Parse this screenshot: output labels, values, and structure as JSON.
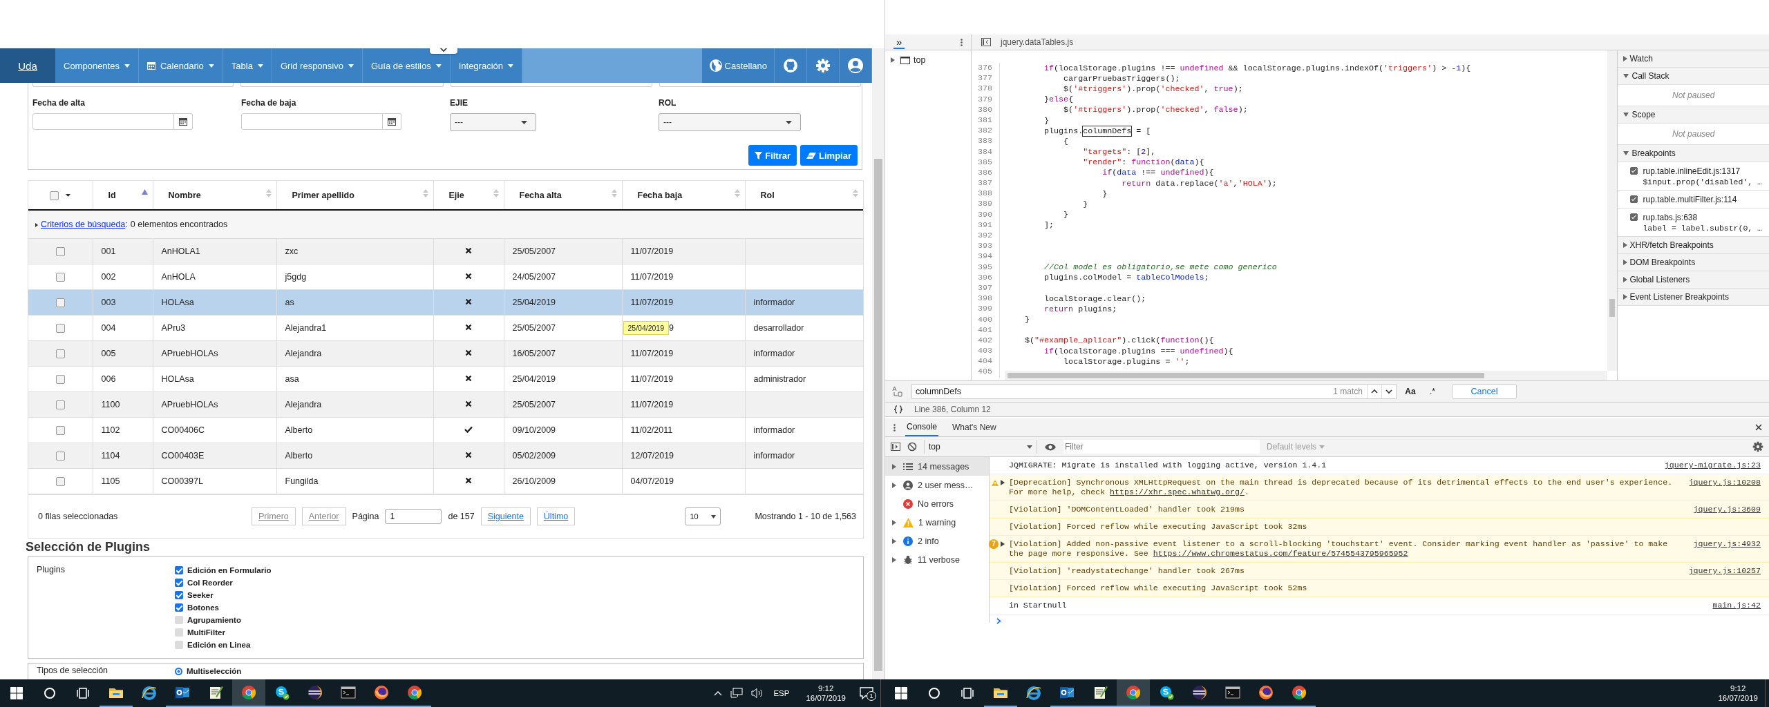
{
  "page": {
    "navbar": {
      "brand": "Uda",
      "menus": [
        {
          "label": "Componentes",
          "kind": "plain"
        },
        {
          "label": "Calendario",
          "kind": "calendar"
        },
        {
          "label": "Tabla",
          "kind": "plain"
        },
        {
          "label": "Grid responsivo",
          "kind": "plain"
        },
        {
          "label": "Guía de estilos",
          "kind": "plain"
        },
        {
          "label": "Integración",
          "kind": "plain"
        }
      ],
      "language": "Castellano"
    },
    "filters": [
      {
        "label": "Fecha de alta",
        "kind": "date"
      },
      {
        "label": "Fecha de baja",
        "kind": "date"
      },
      {
        "label": "EJIE",
        "kind": "select",
        "value": "---"
      },
      {
        "label": "ROL",
        "kind": "select",
        "value": "---"
      }
    ],
    "filter_buttons": [
      {
        "label": "Filtrar",
        "kind": "filter"
      },
      {
        "label": "Limpiar",
        "kind": "clear"
      }
    ],
    "table": {
      "select_all": {
        "checked": false
      },
      "columns": [
        {
          "label": "Id",
          "sorted": true
        },
        {
          "label": "Nombre",
          "sorted": false
        },
        {
          "label": "Primer apellido",
          "sorted": false
        },
        {
          "label": "Ejie",
          "sorted": false
        },
        {
          "label": "Fecha alta",
          "sorted": false
        },
        {
          "label": "Fecha baja",
          "sorted": false
        },
        {
          "label": "Rol",
          "sorted": false
        }
      ],
      "criteria": {
        "link": "Criterios de búsqueda",
        "separator": ":",
        "text": "0 elementos encontrados"
      },
      "rows": [
        {
          "checked": false,
          "selected": false,
          "id": "001",
          "nombre": "AnHOLA1",
          "apellido": "zxc",
          "ejie": false,
          "fecha_alta": "25/05/2007",
          "fecha_baja": "11/07/2019"
        },
        {
          "checked": false,
          "selected": false,
          "id": "002",
          "nombre": "AnHOLA",
          "apellido": "j5gdg",
          "ejie": false,
          "fecha_alta": "24/05/2007",
          "fecha_baja": "11/07/2019"
        },
        {
          "checked": false,
          "selected": true,
          "id": "003",
          "nombre": "HOLAsa",
          "apellido": "as",
          "ejie": false,
          "fecha_alta": "25/04/2019",
          "fecha_baja": "11/07/2019",
          "rol": "informador"
        },
        {
          "checked": false,
          "selected": false,
          "id": "004",
          "nombre": "APru3",
          "apellido": "Alejandra1",
          "ejie": false,
          "fecha_alta": "25/05/2007",
          "tooltip": "25/04/2019",
          "fecha_baja": "9",
          "rol": "desarrollador"
        },
        {
          "checked": false,
          "selected": false,
          "id": "005",
          "nombre": "APruebHOLAs",
          "apellido": "Alejandra",
          "ejie": false,
          "fecha_alta": "16/05/2007",
          "fecha_baja": "11/07/2019",
          "rol": "informador"
        },
        {
          "checked": false,
          "selected": false,
          "id": "006",
          "nombre": "HOLAsa",
          "apellido": "asa",
          "ejie": false,
          "fecha_alta": "25/04/2019",
          "fecha_baja": "11/07/2019",
          "rol": "administrador"
        },
        {
          "checked": false,
          "selected": false,
          "id": "1100",
          "nombre": "APruebHOLAs",
          "apellido": "Alejandra",
          "ejie": false,
          "fecha_alta": "25/05/2007",
          "fecha_baja": "11/07/2019"
        },
        {
          "checked": false,
          "selected": false,
          "id": "1102",
          "nombre": "CO00406C",
          "apellido": "Alberto",
          "ejie": true,
          "fecha_alta": "09/10/2009",
          "fecha_baja": "11/02/2011",
          "rol": "informador"
        },
        {
          "checked": false,
          "selected": false,
          "id": "1104",
          "nombre": "CO00403E",
          "apellido": "Alberto",
          "ejie": false,
          "fecha_alta": "05/02/2009",
          "fecha_baja": "12/07/2019",
          "rol": "informador"
        },
        {
          "checked": false,
          "selected": false,
          "id": "1105",
          "nombre": "CO00397L",
          "apellido": "Fungilda",
          "ejie": false,
          "fecha_alta": "26/10/2009",
          "fecha_baja": "04/07/2019"
        }
      ],
      "footer": {
        "selected_text": "0 filas seleccionadas",
        "pager": [
          {
            "label": "Primero",
            "disabled": true
          },
          {
            "label": "Anterior",
            "disabled": true
          }
        ],
        "page_label": "Página",
        "page_value": "1",
        "page_total": "de 157",
        "pager_next": [
          {
            "label": "Siguiente",
            "disabled": false
          },
          {
            "label": "Último",
            "disabled": false
          }
        ],
        "page_size": "10",
        "summary": "Mostrando 1 - 10 de 1,563"
      }
    },
    "plugins_heading": "Selección de Plugins",
    "plugins": {
      "label": "Plugins",
      "options": [
        {
          "label": "Edición en Formulario",
          "checked": true
        },
        {
          "label": "Col Reorder",
          "checked": true
        },
        {
          "label": "Seeker",
          "checked": true
        },
        {
          "label": "Botones",
          "checked": true
        },
        {
          "label": "Agrupamiento",
          "checked": false
        },
        {
          "label": "MultiFilter",
          "checked": false
        },
        {
          "label": "Edición en Linea",
          "checked": false
        }
      ]
    },
    "selection_types": {
      "label": "Tipos de selección",
      "options": [
        {
          "label": "Multiselección",
          "selected": true
        }
      ]
    }
  },
  "devtools": {
    "file_tab": "jquery.dataTables.js",
    "navigator": {
      "more": "»",
      "items": [
        {
          "label": "top"
        }
      ]
    },
    "code": {
      "lines": [
        {
          "n": "376",
          "tokens": [
            {
              "t": "        if",
              "kind": "kw"
            },
            {
              "t": "(localStorage.plugins !== ",
              "kind": "p"
            },
            {
              "t": "undefined",
              "kind": "kw"
            },
            {
              "t": " && localStorage.plugins.indexOf(",
              "kind": "p"
            },
            {
              "t": "'triggers'",
              "kind": "str"
            },
            {
              "t": ") > ",
              "kind": "p"
            },
            {
              "t": "-1",
              "kind": "num"
            },
            {
              "t": "){",
              "kind": "p"
            }
          ]
        },
        {
          "n": "377",
          "tokens": [
            {
              "t": "            cargarPruebasTriggers();",
              "kind": "p"
            }
          ]
        },
        {
          "n": "378",
          "tokens": [
            {
              "t": "            $(",
              "kind": "p"
            },
            {
              "t": "'#triggers'",
              "kind": "str"
            },
            {
              "t": ").prop(",
              "kind": "p"
            },
            {
              "t": "'checked'",
              "kind": "str"
            },
            {
              "t": ", ",
              "kind": "p"
            },
            {
              "t": "true",
              "kind": "kw"
            },
            {
              "t": ");",
              "kind": "p"
            }
          ]
        },
        {
          "n": "379",
          "tokens": [
            {
              "t": "        }",
              "kind": "p"
            },
            {
              "t": "else",
              "kind": "kw"
            },
            {
              "t": "{",
              "kind": "p"
            }
          ]
        },
        {
          "n": "380",
          "tokens": [
            {
              "t": "            $(",
              "kind": "p"
            },
            {
              "t": "'#triggers'",
              "kind": "str"
            },
            {
              "t": ").prop(",
              "kind": "p"
            },
            {
              "t": "'checked'",
              "kind": "str"
            },
            {
              "t": ", ",
              "kind": "p"
            },
            {
              "t": "false",
              "kind": "kw"
            },
            {
              "t": ");",
              "kind": "p"
            }
          ]
        },
        {
          "n": "381",
          "tokens": [
            {
              "t": "        }",
              "kind": "p"
            }
          ]
        },
        {
          "n": "382",
          "tokens": [
            {
              "t": "        plugins.",
              "kind": "p"
            },
            {
              "t": "columnDefs",
              "kind": "match"
            },
            {
              "t": " = [",
              "kind": "p"
            }
          ]
        },
        {
          "n": "383",
          "tokens": [
            {
              "t": "            {",
              "kind": "p"
            }
          ]
        },
        {
          "n": "384",
          "tokens": [
            {
              "t": "                \"targets\"",
              "kind": "str"
            },
            {
              "t": ": [",
              "kind": "p"
            },
            {
              "t": "2",
              "kind": "num"
            },
            {
              "t": "],",
              "kind": "p"
            }
          ]
        },
        {
          "n": "385",
          "tokens": [
            {
              "t": "                \"render\"",
              "kind": "str"
            },
            {
              "t": ": ",
              "kind": "p"
            },
            {
              "t": "function",
              "kind": "kw"
            },
            {
              "t": "(",
              "kind": "p"
            },
            {
              "t": "data",
              "kind": "var"
            },
            {
              "t": "){",
              "kind": "p"
            }
          ]
        },
        {
          "n": "386",
          "tokens": [
            {
              "t": "                    if",
              "kind": "kw"
            },
            {
              "t": "(",
              "kind": "p"
            },
            {
              "t": "data",
              "kind": "var"
            },
            {
              "t": " !== ",
              "kind": "p"
            },
            {
              "t": "undefined",
              "kind": "kw"
            },
            {
              "t": "){",
              "kind": "p"
            }
          ]
        },
        {
          "n": "387",
          "tokens": [
            {
              "t": "                        return",
              "kind": "kw"
            },
            {
              "t": " data.replace(",
              "kind": "p"
            },
            {
              "t": "'a'",
              "kind": "str"
            },
            {
              "t": ",",
              "kind": "p"
            },
            {
              "t": "'HOLA'",
              "kind": "str"
            },
            {
              "t": ");",
              "kind": "p"
            }
          ]
        },
        {
          "n": "388",
          "tokens": [
            {
              "t": "                    }",
              "kind": "p"
            }
          ]
        },
        {
          "n": "389",
          "tokens": [
            {
              "t": "                }",
              "kind": "p"
            }
          ]
        },
        {
          "n": "390",
          "tokens": [
            {
              "t": "            }",
              "kind": "p"
            }
          ]
        },
        {
          "n": "391",
          "tokens": [
            {
              "t": "        ];",
              "kind": "p"
            }
          ]
        },
        {
          "n": "392"
        },
        {
          "n": "393"
        },
        {
          "n": "394"
        },
        {
          "n": "395",
          "tokens": [
            {
              "t": "        //Col model es obligatorio,se mete como generico",
              "kind": "com"
            }
          ]
        },
        {
          "n": "396",
          "tokens": [
            {
              "t": "        plugins.colModel = ",
              "kind": "p"
            },
            {
              "t": "tableColModels",
              "kind": "var"
            },
            {
              "t": ";",
              "kind": "p"
            }
          ]
        },
        {
          "n": "397"
        },
        {
          "n": "398",
          "tokens": [
            {
              "t": "        localStorage.clear();",
              "kind": "p"
            }
          ]
        },
        {
          "n": "399",
          "tokens": [
            {
              "t": "        return",
              "kind": "kw"
            },
            {
              "t": " plugins;",
              "kind": "p"
            }
          ]
        },
        {
          "n": "400",
          "tokens": [
            {
              "t": "    }",
              "kind": "p"
            }
          ]
        },
        {
          "n": "401"
        },
        {
          "n": "402",
          "tokens": [
            {
              "t": "    $(",
              "kind": "p"
            },
            {
              "t": "\"#example_aplicar\"",
              "kind": "str"
            },
            {
              "t": ").click(",
              "kind": "p"
            },
            {
              "t": "function",
              "kind": "kw"
            },
            {
              "t": "(){",
              "kind": "p"
            }
          ]
        },
        {
          "n": "403",
          "tokens": [
            {
              "t": "        if",
              "kind": "kw"
            },
            {
              "t": "(localStorage.plugins === ",
              "kind": "p"
            },
            {
              "t": "undefined",
              "kind": "kw"
            },
            {
              "t": "){",
              "kind": "p"
            }
          ]
        },
        {
          "n": "404",
          "tokens": [
            {
              "t": "            localStorage.plugins = ",
              "kind": "p"
            },
            {
              "t": "''",
              "kind": "str"
            },
            {
              "t": ";",
              "kind": "p"
            }
          ]
        },
        {
          "n": "405"
        }
      ]
    },
    "sidebar": [
      {
        "title": "Watch",
        "expanded": false
      },
      {
        "title": "Call Stack",
        "expanded": true,
        "empty": "Not paused"
      },
      {
        "title": "Scope",
        "expanded": true,
        "empty": "Not paused"
      },
      {
        "title": "Breakpoints",
        "expanded": true,
        "breakpoints": [
          {
            "checked": true,
            "file": "rup.table.inlineEdit.js:1317",
            "code": "$input.prop('disabled', …"
          },
          {
            "checked": true,
            "file": "rup.table.multiFilter.js:114"
          },
          {
            "checked": true,
            "file": "rup.tabs.js:638",
            "code": "label = label.substr(0, …"
          }
        ]
      },
      {
        "title": "XHR/fetch Breakpoints",
        "expanded": false
      },
      {
        "title": "DOM Breakpoints",
        "expanded": false
      },
      {
        "title": "Global Listeners",
        "expanded": false
      },
      {
        "title": "Event Listener Breakpoints",
        "expanded": false
      }
    ],
    "search": {
      "value": "columnDefs",
      "matches": "1 match",
      "case": "Aa",
      "regex": ".*",
      "cancel": "Cancel"
    },
    "status": "Line 386, Column 12",
    "drawer_tabs": [
      {
        "label": "Console",
        "selected": true
      },
      {
        "label": "What's New",
        "selected": false
      }
    ],
    "console": {
      "context": "top",
      "filter_placeholder": "Filter",
      "levels": "Default levels",
      "sidebar": [
        {
          "label": "14 messages",
          "kind": "messages",
          "selected": true,
          "expandable": true
        },
        {
          "label": "2 user mess…",
          "kind": "user",
          "selected": false,
          "expandable": true
        },
        {
          "label": "No errors",
          "kind": "error",
          "selected": false,
          "expandable": false
        },
        {
          "label": "1 warning",
          "kind": "warning",
          "selected": false,
          "expandable": true
        },
        {
          "label": "2 info",
          "kind": "info",
          "selected": false,
          "expandable": true
        },
        {
          "label": "11 verbose",
          "kind": "verbose",
          "selected": false,
          "expandable": true
        }
      ],
      "messages": [
        {
          "kind": "info",
          "expandable": false,
          "parts": [
            {
              "text": "JQMIGRATE: Migrate is installed with logging active, version 1.4.1",
              "kind": "text"
            }
          ],
          "source": "jquery-migrate.js:23"
        },
        {
          "kind": "warning",
          "expandable": true,
          "parts": [
            {
              "text": "[Deprecation] Synchronous XMLHttpRequest on the main thread is deprecated because of its detrimental effects to the end user's experience. For more help, check ",
              "kind": "text"
            },
            {
              "text": "https://xhr.spec.whatwg.org/",
              "kind": "link"
            },
            {
              "text": ".",
              "kind": "text"
            }
          ],
          "source": "jquery.js:10208"
        },
        {
          "kind": "violation",
          "expandable": false,
          "parts": [
            {
              "text": "[Violation] 'DOMContentLoaded' handler took 219ms",
              "kind": "text"
            }
          ],
          "source": "jquery.js:3609"
        },
        {
          "kind": "violation",
          "expandable": false,
          "parts": [
            {
              "text": "[Violation] Forced reflow while executing JavaScript took 32ms",
              "kind": "text"
            }
          ]
        },
        {
          "kind": "violation",
          "expandable": true,
          "count": "7",
          "parts": [
            {
              "text": "[Violation] Added non-passive event listener to a scroll-blocking 'touchstart' event. Consider marking event handler as 'passive' to make the page more responsive. See ",
              "kind": "text"
            },
            {
              "text": "https://www.chromestatus.com/feature/5745543795965952",
              "kind": "link"
            }
          ],
          "source": "jquery.js:4932"
        },
        {
          "kind": "violation",
          "expandable": false,
          "parts": [
            {
              "text": "[Violation] 'readystatechange' handler took 267ms",
              "kind": "text"
            }
          ],
          "source": "jquery.js:10257"
        },
        {
          "kind": "violation",
          "expandable": false,
          "parts": [
            {
              "text": "[Violation] Forced reflow while executing JavaScript took 52ms",
              "kind": "text"
            }
          ]
        },
        {
          "kind": "info",
          "expandable": false,
          "parts": [
            {
              "text": "in Startnull",
              "kind": "text"
            }
          ],
          "source": "main.js:42"
        }
      ]
    }
  },
  "taskbars": [
    {
      "items": [
        {
          "kind": "start"
        },
        {
          "kind": "search"
        },
        {
          "kind": "taskview"
        },
        {
          "kind": "folder",
          "running": true,
          "selected": false
        },
        {
          "kind": "ie",
          "running": false,
          "selected": false
        },
        {
          "kind": "mail",
          "running": true,
          "selected": false
        },
        {
          "kind": "notepad",
          "running": true,
          "selected": false
        },
        {
          "kind": "chrome",
          "running": true,
          "selected": true
        },
        {
          "kind": "skype",
          "running": true,
          "selected": false
        },
        {
          "kind": "eclipse",
          "running": true,
          "selected": false
        },
        {
          "kind": "terminal",
          "running": true,
          "selected": false
        },
        {
          "kind": "firefox",
          "running": true,
          "selected": false
        },
        {
          "kind": "chrome",
          "running": true,
          "selected": false
        }
      ],
      "tray": {
        "language": "ESP",
        "notifications": "1"
      },
      "time": "9:12",
      "date": "16/07/2019"
    },
    {
      "items": [
        {
          "kind": "start"
        },
        {
          "kind": "search"
        },
        {
          "kind": "taskview"
        },
        {
          "kind": "folder",
          "running": true,
          "selected": false
        },
        {
          "kind": "ie",
          "running": false,
          "selected": false
        },
        {
          "kind": "mail",
          "running": true,
          "selected": false
        },
        {
          "kind": "notepad",
          "running": true,
          "selected": false
        },
        {
          "kind": "chrome",
          "running": true,
          "selected": true
        },
        {
          "kind": "skype",
          "running": true,
          "selected": false
        },
        {
          "kind": "eclipse",
          "running": true,
          "selected": false
        },
        {
          "kind": "terminal",
          "running": true,
          "selected": false
        },
        {
          "kind": "firefox",
          "running": true,
          "selected": false
        },
        {
          "kind": "chrome",
          "running": true,
          "selected": false
        }
      ],
      "time": "9:12",
      "date": "16/07/2019"
    }
  ]
}
